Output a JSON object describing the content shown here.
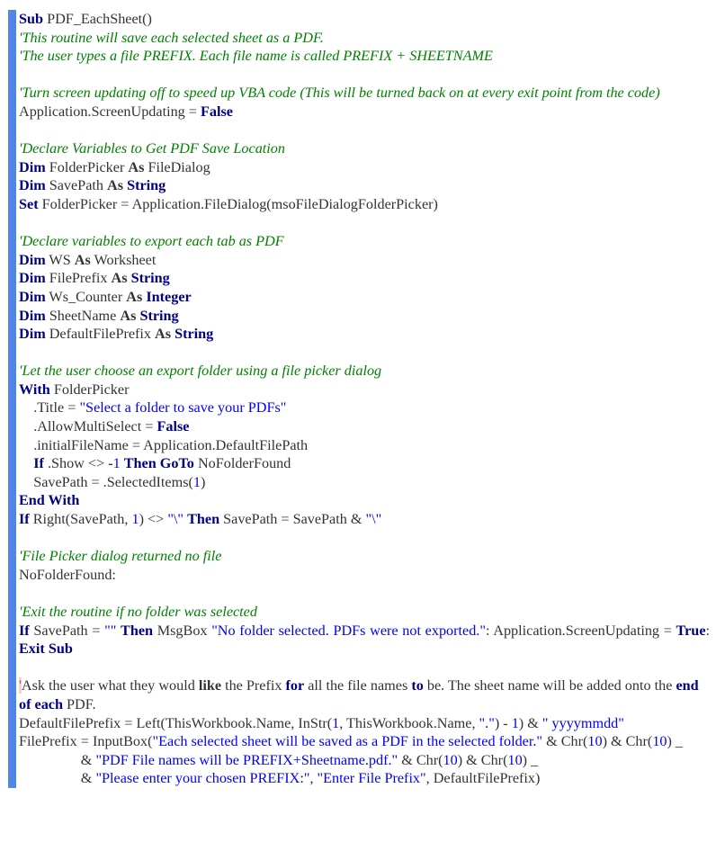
{
  "document": {
    "type": "VBA code listing",
    "accent_bar_color": "#4f86e8",
    "colors": {
      "keyword": "#000080",
      "comment": "#008000",
      "string": "#0000ff",
      "number": "#0000ff",
      "plain": "#333333"
    },
    "lines": [
      {
        "tokens": [
          {
            "t": "kw",
            "v": "Sub"
          },
          {
            "t": "plain",
            "v": " PDF_EachSheet()"
          }
        ]
      },
      {
        "tokens": [
          {
            "t": "cmt",
            "v": "'This routine will save each selected sheet as a PDF."
          }
        ]
      },
      {
        "tokens": [
          {
            "t": "cmt",
            "v": "'The user types a file PREFIX. Each file name is called PREFIX + SHEETNAME"
          }
        ]
      },
      {
        "tokens": []
      },
      {
        "tokens": [
          {
            "t": "cmt",
            "v": "'Turn screen updating off to speed up VBA code (This will be turned back on at every exit point from the code)"
          }
        ]
      },
      {
        "tokens": [
          {
            "t": "plain",
            "v": "Application.ScreenUpdating = "
          },
          {
            "t": "kw",
            "v": "False"
          }
        ]
      },
      {
        "tokens": []
      },
      {
        "tokens": [
          {
            "t": "cmt",
            "v": "'Declare Variables to Get PDF Save Location"
          }
        ]
      },
      {
        "tokens": [
          {
            "t": "kw",
            "v": "Dim"
          },
          {
            "t": "plain",
            "v": " FolderPicker "
          },
          {
            "t": "kd",
            "v": "As"
          },
          {
            "t": "plain",
            "v": " FileDialog"
          }
        ]
      },
      {
        "tokens": [
          {
            "t": "kw",
            "v": "Dim"
          },
          {
            "t": "plain",
            "v": " SavePath "
          },
          {
            "t": "kd",
            "v": "As"
          },
          {
            "t": "plain",
            "v": " "
          },
          {
            "t": "kw",
            "v": "String"
          }
        ]
      },
      {
        "tokens": [
          {
            "t": "kw",
            "v": "Set"
          },
          {
            "t": "plain",
            "v": " FolderPicker = Application.FileDialog(msoFileDialogFolderPicker)"
          }
        ]
      },
      {
        "tokens": []
      },
      {
        "tokens": [
          {
            "t": "cmt",
            "v": "'Declare variables to export each tab as PDF"
          }
        ]
      },
      {
        "tokens": [
          {
            "t": "kw",
            "v": "Dim"
          },
          {
            "t": "plain",
            "v": " WS "
          },
          {
            "t": "kd",
            "v": "As"
          },
          {
            "t": "plain",
            "v": " Worksheet"
          }
        ]
      },
      {
        "tokens": [
          {
            "t": "kw",
            "v": "Dim"
          },
          {
            "t": "plain",
            "v": " FilePrefix "
          },
          {
            "t": "kd",
            "v": "As"
          },
          {
            "t": "plain",
            "v": " "
          },
          {
            "t": "kw",
            "v": "String"
          }
        ]
      },
      {
        "tokens": [
          {
            "t": "kw",
            "v": "Dim"
          },
          {
            "t": "plain",
            "v": " Ws_Counter "
          },
          {
            "t": "kd",
            "v": "As"
          },
          {
            "t": "plain",
            "v": " "
          },
          {
            "t": "kw",
            "v": "Integer"
          }
        ]
      },
      {
        "tokens": [
          {
            "t": "kw",
            "v": "Dim"
          },
          {
            "t": "plain",
            "v": " SheetName "
          },
          {
            "t": "kd",
            "v": "As"
          },
          {
            "t": "plain",
            "v": " "
          },
          {
            "t": "kw",
            "v": "String"
          }
        ]
      },
      {
        "tokens": [
          {
            "t": "kw",
            "v": "Dim"
          },
          {
            "t": "plain",
            "v": " DefaultFilePrefix "
          },
          {
            "t": "kd",
            "v": "As"
          },
          {
            "t": "plain",
            "v": " "
          },
          {
            "t": "kw",
            "v": "String"
          }
        ]
      },
      {
        "tokens": []
      },
      {
        "tokens": [
          {
            "t": "cmt",
            "v": "'Let the user choose an export folder using a file picker dialog"
          }
        ]
      },
      {
        "tokens": [
          {
            "t": "kw",
            "v": "With"
          },
          {
            "t": "plain",
            "v": " FolderPicker"
          }
        ]
      },
      {
        "tokens": [
          {
            "t": "plain",
            "v": "    .Title = "
          },
          {
            "t": "str",
            "v": "\"Select a folder to save your PDFs\""
          }
        ]
      },
      {
        "tokens": [
          {
            "t": "plain",
            "v": "    .AllowMultiSelect = "
          },
          {
            "t": "kw",
            "v": "False"
          }
        ]
      },
      {
        "tokens": [
          {
            "t": "plain",
            "v": "    .initialFileName = Application.DefaultFilePath"
          }
        ]
      },
      {
        "tokens": [
          {
            "t": "plain",
            "v": "    "
          },
          {
            "t": "kw",
            "v": "If"
          },
          {
            "t": "plain",
            "v": " .Show <> "
          },
          {
            "t": "kd",
            "v": "-"
          },
          {
            "t": "num",
            "v": "1"
          },
          {
            "t": "plain",
            "v": " "
          },
          {
            "t": "kw",
            "v": "Then"
          },
          {
            "t": "plain",
            "v": " "
          },
          {
            "t": "kw",
            "v": "GoTo"
          },
          {
            "t": "plain",
            "v": " NoFolderFound"
          }
        ]
      },
      {
        "tokens": [
          {
            "t": "plain",
            "v": "    SavePath = .SelectedItems("
          },
          {
            "t": "num",
            "v": "1"
          },
          {
            "t": "plain",
            "v": ")"
          }
        ]
      },
      {
        "tokens": [
          {
            "t": "kw",
            "v": "End With"
          }
        ]
      },
      {
        "tokens": [
          {
            "t": "kw",
            "v": "If"
          },
          {
            "t": "plain",
            "v": " Right(SavePath, "
          },
          {
            "t": "num",
            "v": "1"
          },
          {
            "t": "plain",
            "v": ") <> "
          },
          {
            "t": "str",
            "v": "\"\\\""
          },
          {
            "t": "plain",
            "v": " "
          },
          {
            "t": "kw",
            "v": "Then"
          },
          {
            "t": "plain",
            "v": " SavePath = SavePath & "
          },
          {
            "t": "str",
            "v": "\"\\\""
          }
        ]
      },
      {
        "tokens": []
      },
      {
        "tokens": [
          {
            "t": "cmt",
            "v": "'File Picker dialog returned no file"
          }
        ]
      },
      {
        "tokens": [
          {
            "t": "plain",
            "v": "NoFolderFound:"
          }
        ]
      },
      {
        "tokens": []
      },
      {
        "tokens": [
          {
            "t": "cmt",
            "v": "'Exit the routine if no folder was selected"
          }
        ]
      },
      {
        "justify": true,
        "tokens": [
          {
            "t": "kw",
            "v": "If"
          },
          {
            "t": "plain",
            "v": " SavePath = "
          },
          {
            "t": "str",
            "v": "\"\""
          },
          {
            "t": "plain",
            "v": " "
          },
          {
            "t": "kw",
            "v": "Then"
          },
          {
            "t": "plain",
            "v": " MsgBox "
          },
          {
            "t": "str",
            "v": "\"No folder selected. PDFs were not exported.\""
          },
          {
            "t": "plain",
            "v": ": Application.ScreenUpdating = "
          },
          {
            "t": "kw",
            "v": "True"
          },
          {
            "t": "plain",
            "v": ": "
          },
          {
            "t": "kw",
            "v": "Exit Sub"
          }
        ]
      },
      {
        "tokens": []
      },
      {
        "tokens": [
          {
            "t": "mark",
            "v": "'"
          },
          {
            "t": "plain",
            "v": "Ask the user what they would "
          },
          {
            "t": "kd",
            "v": "like"
          },
          {
            "t": "plain",
            "v": " the Prefix "
          },
          {
            "t": "kw",
            "v": "for"
          },
          {
            "t": "plain",
            "v": " all the file names "
          },
          {
            "t": "kw",
            "v": "to"
          },
          {
            "t": "plain",
            "v": " be. The sheet name will be added onto the "
          },
          {
            "t": "kw",
            "v": "end of each"
          },
          {
            "t": "plain",
            "v": " PDF."
          }
        ]
      },
      {
        "tokens": [
          {
            "t": "plain",
            "v": "DefaultFilePrefix = Left(ThisWorkbook.Name, InStr("
          },
          {
            "t": "num",
            "v": "1"
          },
          {
            "t": "plain",
            "v": ", ThisWorkbook.Name, "
          },
          {
            "t": "str",
            "v": "\".\""
          },
          {
            "t": "plain",
            "v": ") - "
          },
          {
            "t": "num",
            "v": "1"
          },
          {
            "t": "plain",
            "v": ") & "
          },
          {
            "t": "str",
            "v": "\" yyyymmdd\""
          }
        ]
      },
      {
        "tokens": [
          {
            "t": "plain",
            "v": "FilePrefix = InputBox("
          },
          {
            "t": "str",
            "v": "\"Each selected sheet will be saved as a PDF in the selected folder.\""
          },
          {
            "t": "plain",
            "v": " & Chr("
          },
          {
            "t": "num",
            "v": "10"
          },
          {
            "t": "plain",
            "v": ") & Chr("
          },
          {
            "t": "num",
            "v": "10"
          },
          {
            "t": "plain",
            "v": ") _"
          }
        ]
      },
      {
        "tokens": [
          {
            "t": "plain",
            "v": "                 & "
          },
          {
            "t": "str",
            "v": "\"PDF File names will be PREFIX+Sheetname.pdf.\""
          },
          {
            "t": "plain",
            "v": " & Chr("
          },
          {
            "t": "num",
            "v": "10"
          },
          {
            "t": "plain",
            "v": ") & Chr("
          },
          {
            "t": "num",
            "v": "10"
          },
          {
            "t": "plain",
            "v": ") _"
          }
        ]
      },
      {
        "tokens": [
          {
            "t": "plain",
            "v": "                 & "
          },
          {
            "t": "str",
            "v": "\"Please enter your chosen PREFIX:\""
          },
          {
            "t": "plain",
            "v": ", "
          },
          {
            "t": "str",
            "v": "\"Enter File Prefix\""
          },
          {
            "t": "plain",
            "v": ", DefaultFilePrefix)"
          }
        ]
      }
    ]
  }
}
